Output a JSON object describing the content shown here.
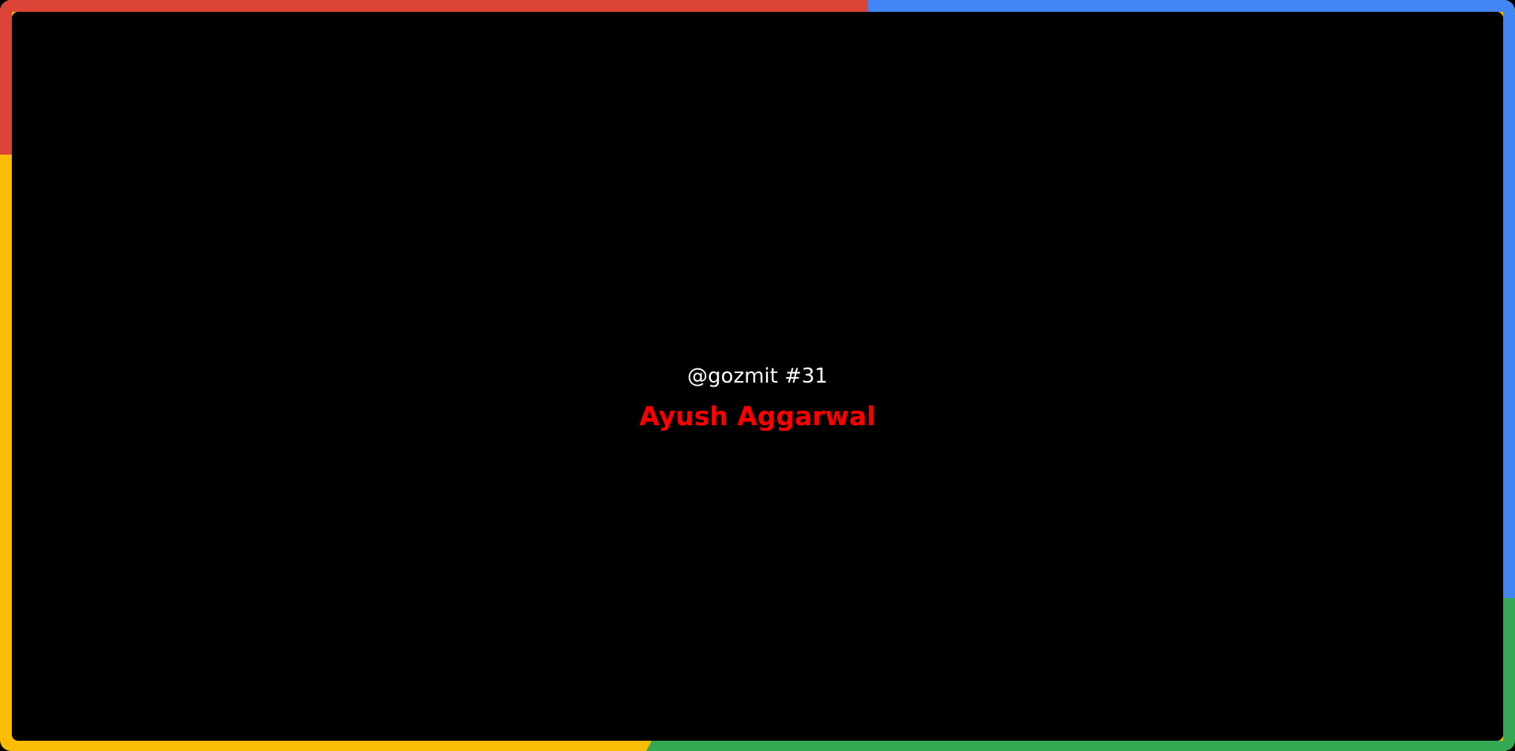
{
  "card": {
    "handle": "@gozmit #31",
    "name": "Ayush Aggarwal"
  },
  "colors": {
    "background": "#000000",
    "handle_text": "#ffffff",
    "name_text": "#ff0000",
    "border_red": "#db4437",
    "border_blue": "#4285f4",
    "border_green": "#34a853",
    "border_yellow": "#fbbc04"
  }
}
